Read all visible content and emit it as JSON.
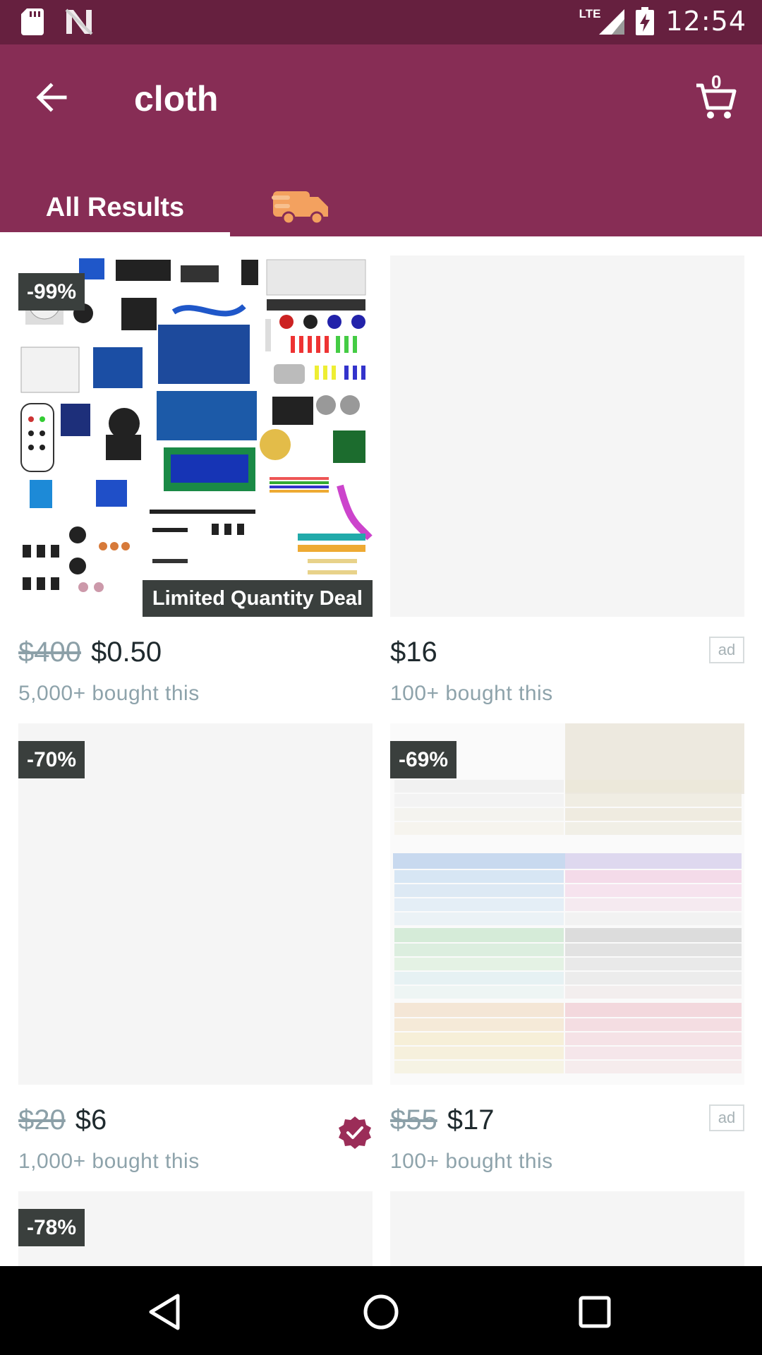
{
  "status_bar": {
    "time": "12:54",
    "network": "LTE",
    "icons": [
      "sd-card-icon",
      "n-logo-icon",
      "signal-icon",
      "battery-charging-icon"
    ]
  },
  "header": {
    "query": "cloth",
    "cart_count": "0",
    "icons": [
      "back-arrow-icon",
      "cart-icon"
    ]
  },
  "tabs": [
    {
      "label": "All Results",
      "selected": true
    },
    {
      "icon": "fast-shipping-icon",
      "selected": false
    }
  ],
  "products": [
    {
      "discount": "-99%",
      "banner": "Limited Quantity Deal",
      "old_price": "$400",
      "price": "$0.50",
      "bought": "5,000+ bought this",
      "ad": false
    },
    {
      "price": "$16",
      "bought": "100+ bought this",
      "ad": true,
      "ad_label": "ad"
    },
    {
      "discount": "-70%",
      "old_price": "$20",
      "price": "$6",
      "bought": "1,000+ bought this",
      "verified": true
    },
    {
      "discount": "-69%",
      "old_price": "$55",
      "price": "$17",
      "bought": "100+ bought this",
      "ad": true,
      "ad_label": "ad"
    },
    {
      "discount": "-78%"
    },
    {}
  ],
  "colors": {
    "status_bar": "#66203f",
    "app_bar": "#872d55",
    "badge": "#3a3f3d",
    "price_muted": "#8ca0a8",
    "bought_text": "#8ea3ab"
  },
  "nav_bar": {
    "icons": [
      "back-triangle-icon",
      "home-circle-icon",
      "recents-square-icon"
    ]
  }
}
